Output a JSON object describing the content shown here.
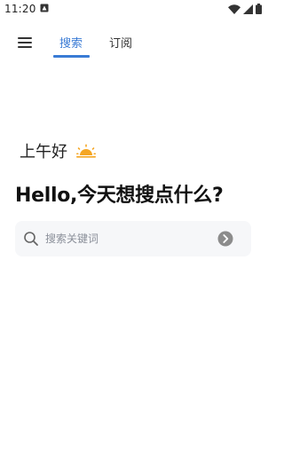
{
  "status_bar": {
    "time": "11:20",
    "icons": [
      "app-notification-icon",
      "wifi-icon",
      "signal-icon",
      "battery-icon"
    ]
  },
  "header": {
    "tabs": [
      {
        "label": "搜索",
        "active": true
      },
      {
        "label": "订阅",
        "active": false
      }
    ],
    "accent_color": "#3a7bd5"
  },
  "main": {
    "greeting": "上午好",
    "greeting_icon": "sunrise-icon",
    "headline": "Hello,今天想搜点什么?",
    "search": {
      "placeholder": "搜索关键词",
      "value": ""
    }
  }
}
